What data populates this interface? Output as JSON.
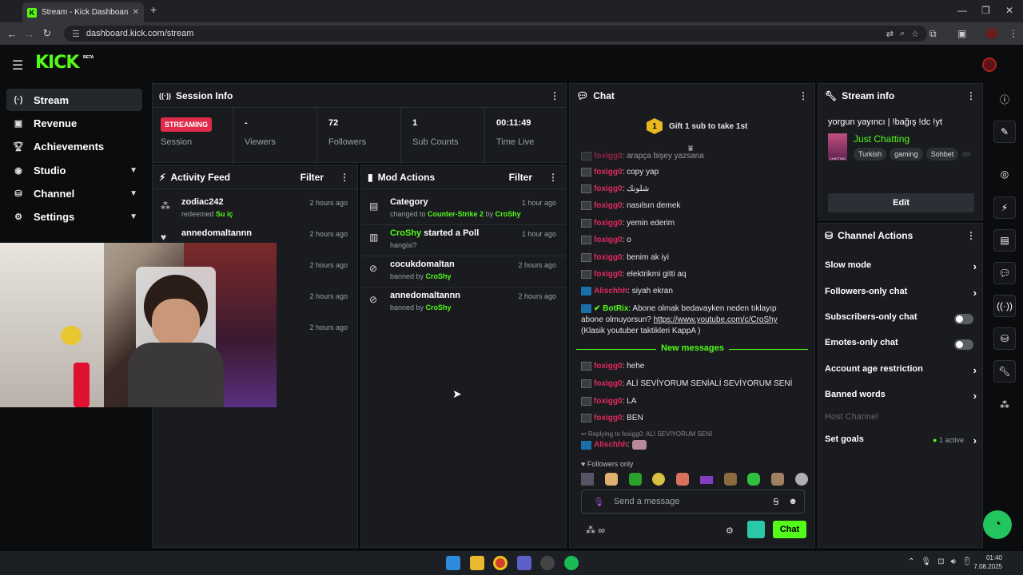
{
  "browser": {
    "tab_title": "Stream - Kick Dashboard",
    "url": "dashboard.kick.com/stream",
    "favicon": "K"
  },
  "header": {
    "logo": "KICK",
    "beta": "BETA"
  },
  "sidebar": {
    "items": [
      {
        "label": "Stream",
        "icon": "broadcast-icon",
        "active": true
      },
      {
        "label": "Revenue",
        "icon": "revenue-icon"
      },
      {
        "label": "Achievements",
        "icon": "trophy-icon"
      },
      {
        "label": "Studio",
        "icon": "studio-icon",
        "expandable": true
      },
      {
        "label": "Channel",
        "icon": "channel-icon",
        "expandable": true
      },
      {
        "label": "Settings",
        "icon": "gear-icon",
        "expandable": true
      }
    ]
  },
  "session": {
    "title": "Session Info",
    "status": "STREAMING",
    "status_label": "Session",
    "viewers": {
      "value": "-",
      "label": "Viewers"
    },
    "followers": {
      "value": "72",
      "label": "Followers"
    },
    "subs": {
      "value": "1",
      "label": "Sub Counts"
    },
    "time": {
      "value": "00:11:49",
      "label": "Time Live"
    }
  },
  "activity": {
    "title": "Activity Feed",
    "filter": "Filter",
    "items": [
      {
        "who": "zodiac242",
        "sub_prefix": "redeemed ",
        "sub_highlight": "Su iç",
        "time": "2 hours ago"
      },
      {
        "who": "annedomaltannn",
        "time": "2 hours ago"
      },
      {
        "time": "2 hours ago"
      },
      {
        "time": "2 hours ago"
      },
      {
        "time": "2 hours ago"
      }
    ]
  },
  "mod": {
    "title": "Mod Actions",
    "filter": "Filter",
    "items": [
      {
        "who": "Category",
        "sub_prefix": "changed to ",
        "sub_highlight": "Counter-Strike 2",
        "sub_mid": " by ",
        "sub_user": "CroShy",
        "time": "1 hour ago"
      },
      {
        "who_user": "CroShy",
        "who": " started a Poll",
        "sub_prefix": "hangisi?",
        "time": "1 hour ago"
      },
      {
        "who": "cocukdomaltan",
        "sub_prefix": "banned by ",
        "sub_user": "CroShy",
        "time": "2 hours ago"
      },
      {
        "who": "annedomaltannn",
        "sub_prefix": "banned by ",
        "sub_user": "CroShy",
        "time": "2 hours ago"
      }
    ]
  },
  "chat": {
    "title": "Chat",
    "gift_num": "1",
    "gift_text": "Gift 1 sub to take 1st",
    "messages": [
      {
        "user": "foxigg0",
        "text": ": arapça bişey yazsana"
      },
      {
        "user": "foxigg0",
        "text": ": copy yap"
      },
      {
        "user": "foxigg0",
        "text": ": شلونك"
      },
      {
        "user": "foxigg0",
        "text": ": nasılsın demek"
      },
      {
        "user": "foxigg0",
        "text": ": yemin ederim"
      },
      {
        "user": "foxigg0",
        "text": ": o"
      },
      {
        "user": "foxigg0",
        "text": ": benim ak iyi"
      },
      {
        "user": "foxigg0",
        "text": ": elektrikmi gitti aq"
      },
      {
        "user": "Alischhh",
        "text": ": siyah ekran"
      }
    ],
    "bot": {
      "user": "BotRix",
      "line1": ": Abone olmak bedavayken neden tıklayıp",
      "line2": "abone olmuyorsun? ",
      "link": "https://www.youtube.com/c/CroShy",
      "line3": "(Klasik youtuber taktikleri KappA )"
    },
    "new_messages": "New messages",
    "new": [
      {
        "user": "foxigg0",
        "text": ": hehe"
      },
      {
        "user": "foxigg0",
        "text": ": ALİ SEVİYORUM SENİALİ SEVİYORUM SENİ"
      },
      {
        "user": "foxigg0",
        "text": ": LA"
      },
      {
        "user": "foxigg0",
        "text": ": BEN"
      }
    ],
    "reply_to": "Replying to foxigg0: ALİ SEVİYORUM SENİ",
    "reply_user": "Alischhh",
    "followers_only": "Followers only",
    "placeholder": "Send a message",
    "send": "Chat"
  },
  "stream_info": {
    "title": "Stream info",
    "stream_title": "yorgun yayıncı | !bağış !dc !yt",
    "category": "Just Chatting",
    "thumb_text": "CHATTING",
    "tags": [
      "Turkish",
      "gaming",
      "Sohbet"
    ],
    "edit": "Edit"
  },
  "channel_actions": {
    "title": "Channel Actions",
    "items": [
      {
        "label": "Slow mode",
        "kind": "chevron"
      },
      {
        "label": "Followers-only chat",
        "kind": "chevron"
      },
      {
        "label": "Subscribers-only chat",
        "kind": "toggle"
      },
      {
        "label": "Emotes-only chat",
        "kind": "toggle"
      },
      {
        "label": "Account age restriction",
        "kind": "chevron"
      },
      {
        "label": "Banned words",
        "kind": "chevron"
      },
      {
        "label": "Host Channel",
        "kind": "disabled"
      },
      {
        "label": "Set goals",
        "kind": "goals",
        "extra": "1 active"
      }
    ]
  },
  "taskbar": {
    "time": "01:40",
    "date": "7.08.2025"
  },
  "colors": {
    "accent": "#53fc18",
    "live": "#e02a4a",
    "username": "#e02a5f",
    "panel": "#191b1f"
  }
}
